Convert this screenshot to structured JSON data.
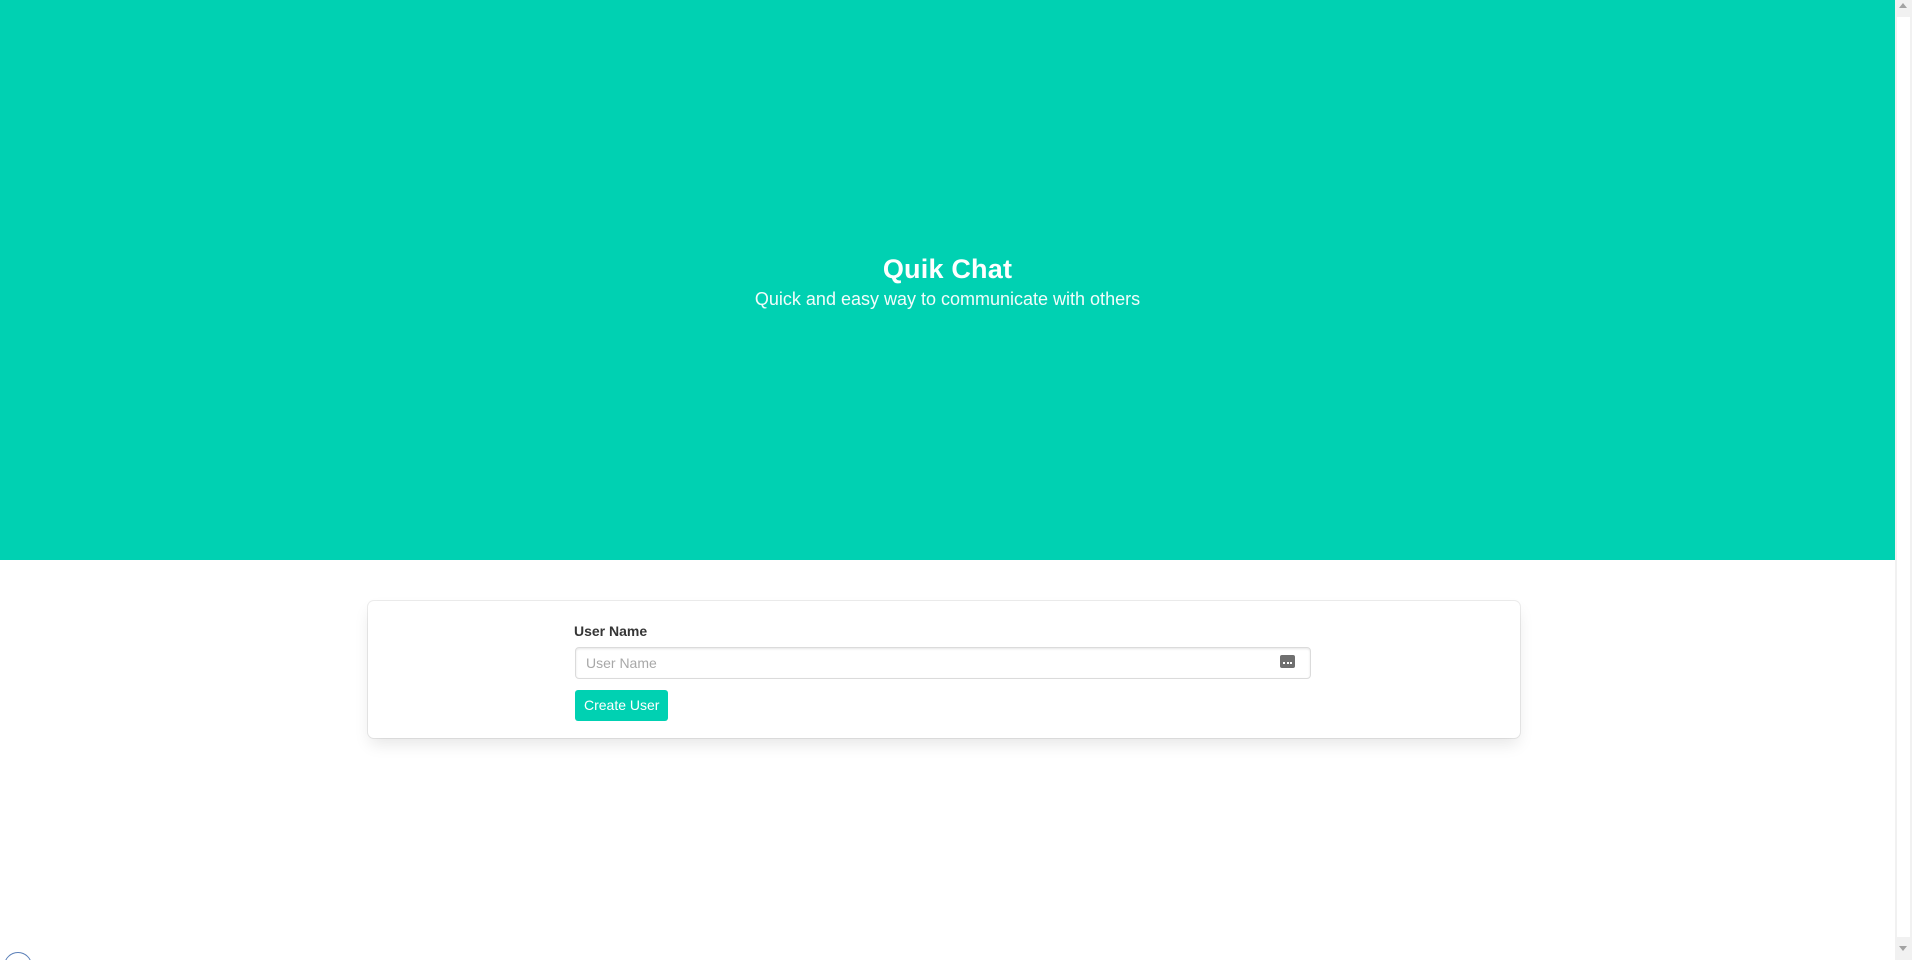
{
  "hero": {
    "title": "Quik Chat",
    "subtitle": "Quick and easy way to communicate with others"
  },
  "form": {
    "label": "User Name",
    "input_placeholder": "User Name",
    "input_value": "",
    "submit_label": "Create User"
  },
  "icons": {
    "input_trailing": "password-manager-icon",
    "corner": "browser-extension-icon"
  },
  "colors": {
    "primary": "#00d1b2",
    "text": "#363636",
    "placeholder": "#a8a8a8"
  }
}
